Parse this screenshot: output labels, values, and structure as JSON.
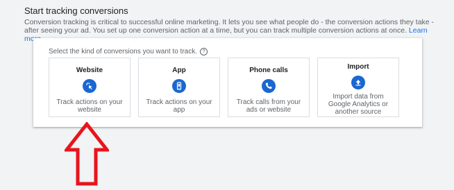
{
  "header": {
    "title": "Start tracking conversions",
    "description": "Conversion tracking is critical to successful online marketing. It lets you see what people do - the conversion actions they take - after seeing your ad. You set up one conversion action at a time, but you can track multiple conversion actions at once.",
    "learn_more": "Learn more"
  },
  "card": {
    "prompt": "Select the kind of conversions you want to track.",
    "help_icon": "?",
    "options": [
      {
        "title": "Website",
        "icon": "web-click-icon",
        "desc": "Track actions on your website"
      },
      {
        "title": "App",
        "icon": "phone-app-icon",
        "desc": "Track actions on your app"
      },
      {
        "title": "Phone calls",
        "icon": "phone-call-icon",
        "desc": "Track calls from your ads or website"
      },
      {
        "title": "Import",
        "icon": "upload-icon",
        "desc": "Import data from Google Analytics or another source"
      }
    ]
  },
  "colors": {
    "accent": "#1967d2",
    "link": "#1a73e8",
    "annotation_arrow": "#e8151b"
  }
}
